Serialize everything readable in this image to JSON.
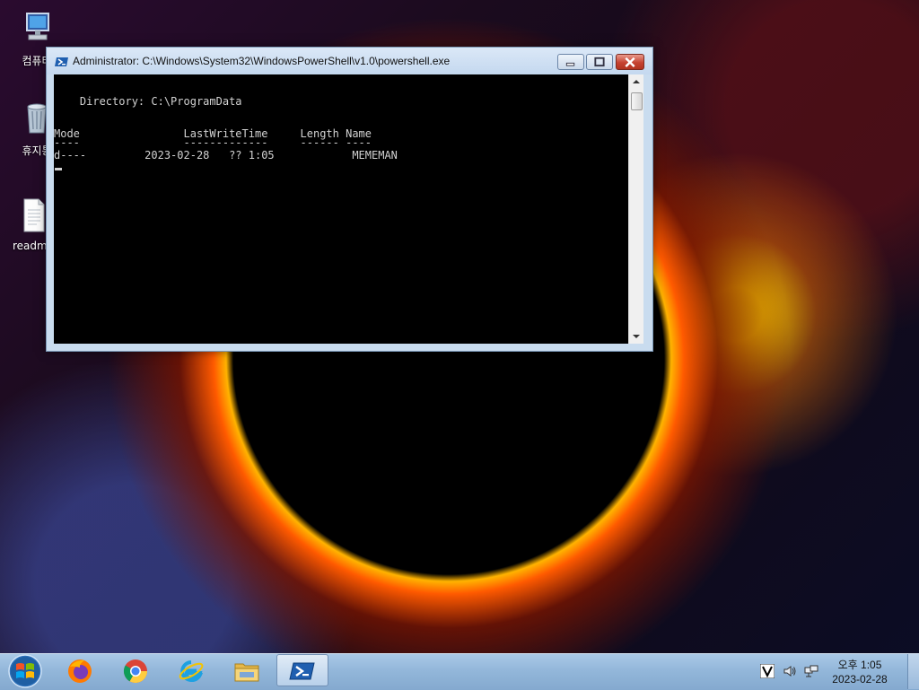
{
  "desktop": {
    "icons": [
      {
        "label": "컴퓨터",
        "icon": "computer-icon"
      },
      {
        "label": "휴지통",
        "icon": "recycle-bin-icon"
      },
      {
        "label": "readme",
        "icon": "text-file-icon"
      }
    ]
  },
  "window": {
    "title": "Administrator: C:\\Windows\\System32\\WindowsPowerShell\\v1.0\\powershell.exe",
    "icon": "powershell-icon",
    "console": {
      "directory_line": "    Directory: C:\\ProgramData",
      "header_line": "Mode                LastWriteTime     Length Name",
      "rule_line": "----                -------------     ------ ----",
      "data_line": "d----         2023-02-28   ?? 1:05            MEMEMAN"
    }
  },
  "taskbar": {
    "items": [
      {
        "name": "firefox",
        "icon": "firefox-icon"
      },
      {
        "name": "chrome",
        "icon": "chrome-icon"
      },
      {
        "name": "internet-explorer",
        "icon": "internet-explorer-icon"
      },
      {
        "name": "file-explorer",
        "icon": "folder-icon"
      },
      {
        "name": "powershell",
        "icon": "powershell-icon",
        "active": true
      }
    ],
    "tray_icons": [
      "ime-icon",
      "volume-icon",
      "network-icon"
    ],
    "clock": {
      "time": "오후 1:05",
      "date": "2023-02-28"
    }
  }
}
